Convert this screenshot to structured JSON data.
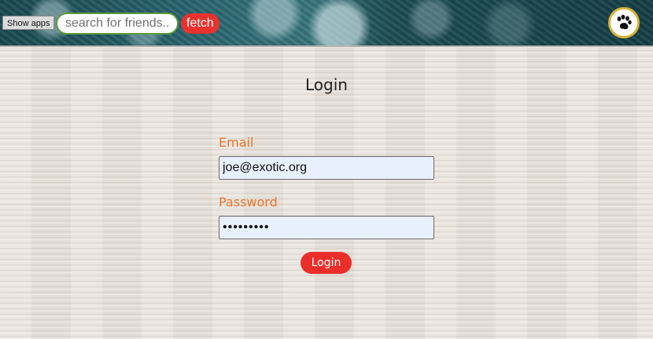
{
  "header": {
    "show_apps_label": "Show apps",
    "search": {
      "placeholder": "search for friends..",
      "value": ""
    },
    "fetch_label": "fetch",
    "avatar_icon": "paw-icon"
  },
  "login": {
    "title": "Login",
    "email_label": "Email",
    "email_value": "joe@exotic.org",
    "password_label": "Password",
    "password_value": "123456789",
    "submit_label": "Login"
  },
  "colors": {
    "accent_red": "#e8322d",
    "label_orange": "#e8762d",
    "search_border_green": "#5e9a3f",
    "avatar_border_gold": "#d7b437",
    "header_teal": "#1e4d55"
  }
}
